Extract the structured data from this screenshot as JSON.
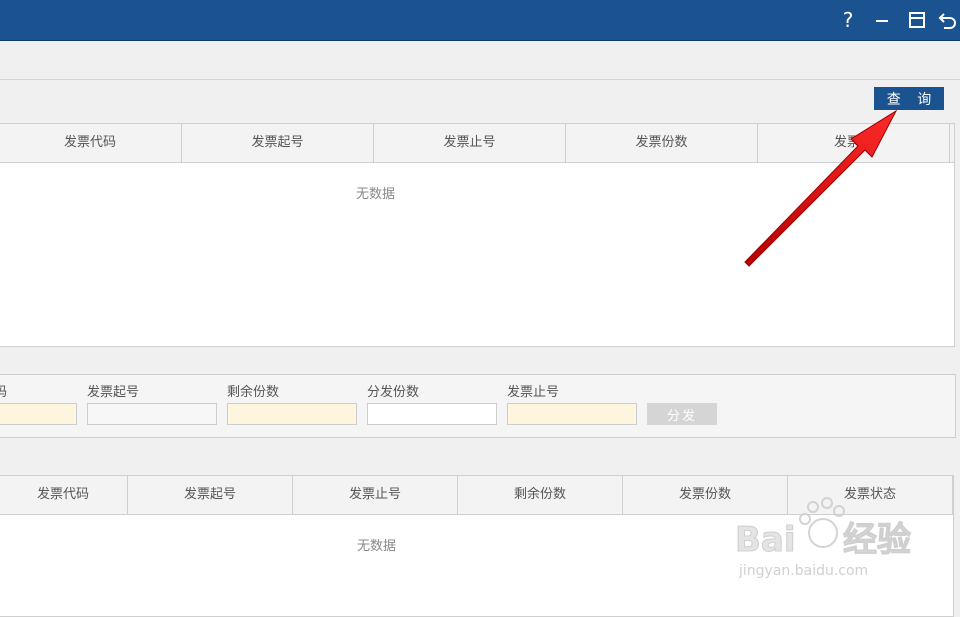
{
  "window": {
    "help_glyph": "?",
    "controls": [
      "help-icon",
      "minimize-icon",
      "maximize-icon",
      "back-icon"
    ],
    "title_bar_color": "#1b5391"
  },
  "query_button": {
    "label": "查 询"
  },
  "invoice_table": {
    "columns": [
      "发票代码",
      "发票起号",
      "发票止号",
      "发票份数",
      "发票状"
    ],
    "empty_text": "无数据"
  },
  "distribution_form": {
    "fields": [
      {
        "label": "码",
        "value": ""
      },
      {
        "label": "发票起号",
        "value": ""
      },
      {
        "label": "剩余份数",
        "value": ""
      },
      {
        "label": "分发份数",
        "value": ""
      },
      {
        "label": "发票止号",
        "value": ""
      }
    ],
    "distribute_button": "分发"
  },
  "distributed_table": {
    "columns": [
      "发票代码",
      "发票起号",
      "发票止号",
      "剩余份数",
      "发票份数",
      "发票状态"
    ],
    "empty_text": "无数据"
  },
  "annotation": {
    "arrow_color": "#e01b1b"
  },
  "watermark": {
    "brand": "Baidu经验",
    "url": "jingyan.baidu.com"
  }
}
